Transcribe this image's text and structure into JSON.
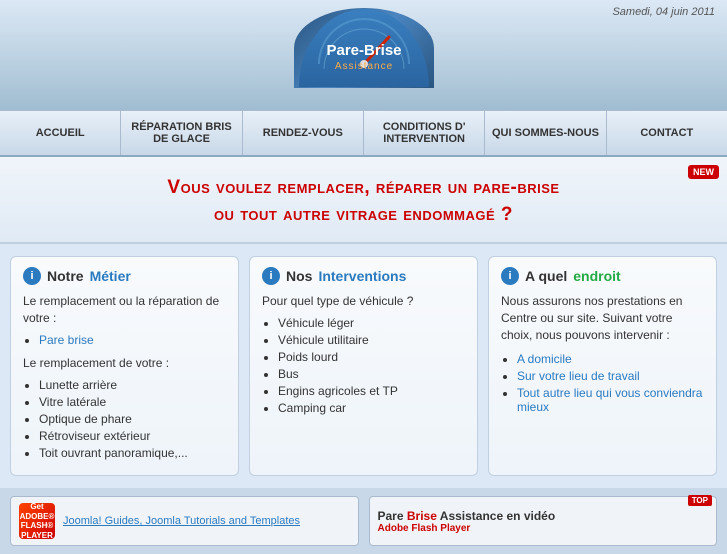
{
  "header": {
    "date": "Samedi, 04 juin 2011",
    "logo_name": "Pare-Brise",
    "logo_name2": "Assistance"
  },
  "nav": {
    "items": [
      {
        "id": "accueil",
        "label": "ACCUEIL"
      },
      {
        "id": "reparation",
        "label": "RÉPARATION BRIS DE GLACE"
      },
      {
        "id": "rendez-vous",
        "label": "RENDEZ-VOUS"
      },
      {
        "id": "conditions",
        "label": "CONDITIONS D' INTERVENTION"
      },
      {
        "id": "qui",
        "label": "QUI SOMMES-NOUS"
      },
      {
        "id": "contact",
        "label": "CONTACT"
      }
    ]
  },
  "hero": {
    "line1": "Vous voulez remplacer, réparer un pare-brise",
    "line2": "ou tout autre vitrage endommagé ?",
    "badge": "NEW"
  },
  "cards": [
    {
      "id": "metier",
      "icon": "i",
      "title_prefix": "Notre ",
      "title_highlight": "Métier",
      "paragraphs": [
        "Le remplacement ou la réparation de votre :"
      ],
      "links": [
        "Pare brise"
      ],
      "paragraphs2": [
        "Le remplacement de votre :"
      ],
      "list": [
        "Lunette arrière",
        "Vitre latérale",
        "Optique de phare",
        "Rétroviseur extérieur",
        "Toit ouvrant panoramique,..."
      ]
    },
    {
      "id": "interventions",
      "icon": "i",
      "title_prefix": "Nos ",
      "title_highlight": "Interventions",
      "paragraphs": [
        "Pour quel type de véhicule ?"
      ],
      "list": [
        "Véhicule léger",
        "Véhicule utilitaire",
        "Poids lourd",
        "Bus",
        "Engins agricoles et TP",
        "Camping car"
      ]
    },
    {
      "id": "endroit",
      "icon": "i",
      "title_prefix": "A quel ",
      "title_highlight": "endroit",
      "paragraphs": [
        "Nous assurons nos prestations en Centre ou sur site. Suivant votre choix, nous pouvons intervenir :"
      ],
      "list": [
        "A domicile",
        "Sur votre lieu de travail",
        "Tout autre lieu qui vous conviendra mieux"
      ]
    }
  ],
  "bottom": {
    "left": {
      "flash_label": "Get\nADOBE®\nFLASH®\nPLAYER",
      "link_text": "Joomla! Guides, Joomla Tutorials and Templates"
    },
    "right": {
      "title_prefix": "Pare ",
      "title_red": "Brise",
      "title_suffix": " Assistance en vidéo",
      "subtitle": "Adobe Flash Player",
      "badge": "TOP"
    }
  }
}
